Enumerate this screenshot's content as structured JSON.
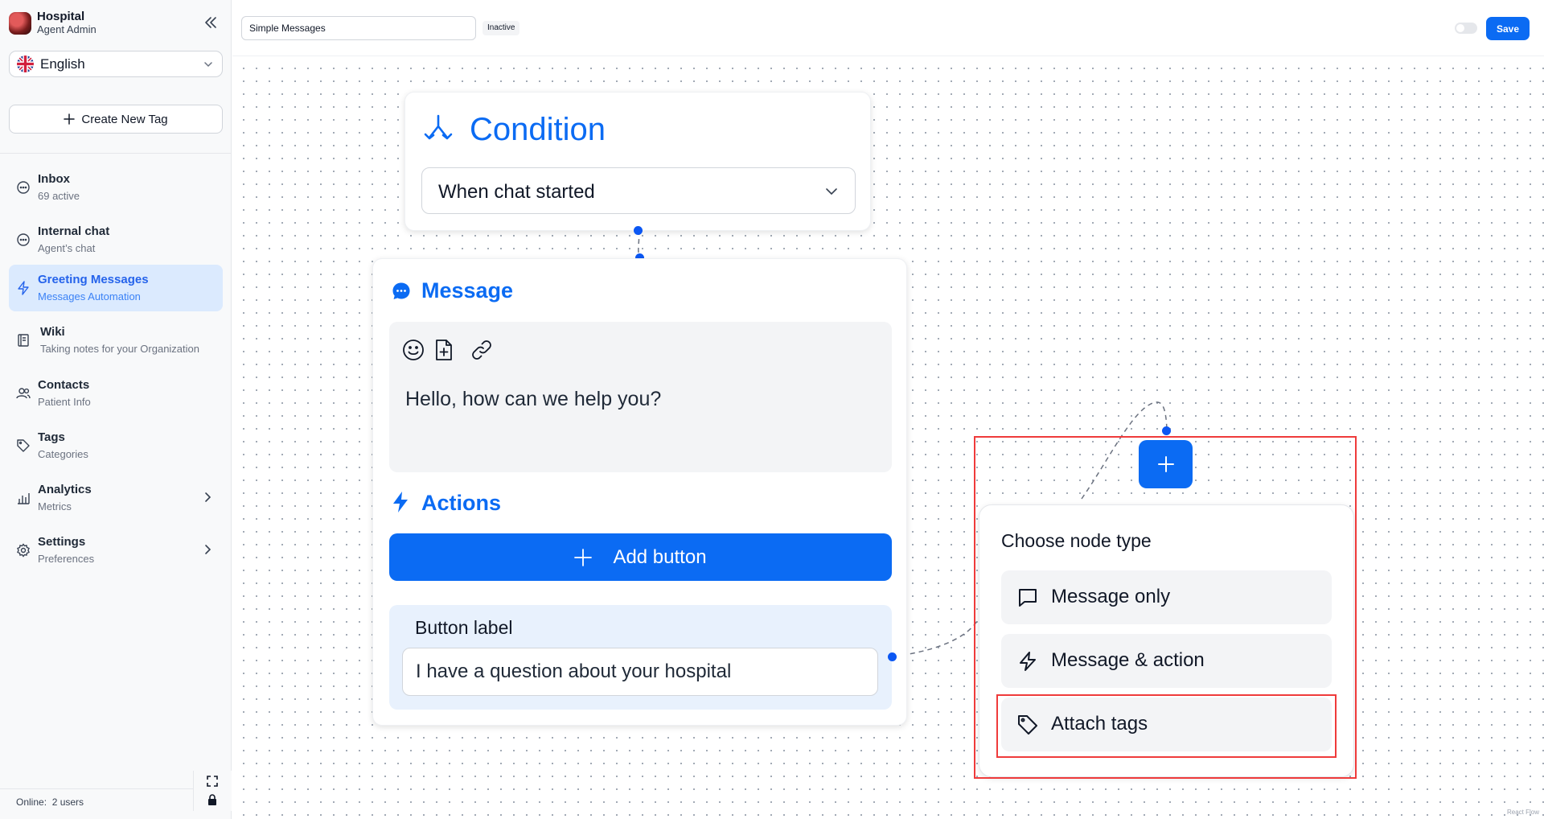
{
  "sidebar": {
    "brand_name": "Hospital",
    "brand_role": "Agent Admin",
    "language": "English",
    "create_tag_label": "Create New Tag",
    "items": [
      {
        "title": "Inbox",
        "sub": "69 active"
      },
      {
        "title": "Internal chat",
        "sub": "Agent’s chat"
      },
      {
        "title": "Greeting Messages",
        "sub": "Messages Automation"
      },
      {
        "title": "Wiki",
        "sub": "Taking notes for your Organization"
      },
      {
        "title": "Contacts",
        "sub": "Patient Info"
      },
      {
        "title": "Tags",
        "sub": "Categories"
      },
      {
        "title": "Analytics",
        "sub": "Metrics"
      },
      {
        "title": "Settings",
        "sub": "Preferences"
      }
    ],
    "online_label": "Online:",
    "online_value": "2 users"
  },
  "header": {
    "flow_name": "Simple Messages",
    "status": "Inactive",
    "save_label": "Save"
  },
  "condition_node": {
    "title": "Condition",
    "selected": "When chat started"
  },
  "message_node": {
    "title": "Message",
    "text": "Hello, how can we help you?",
    "actions_title": "Actions",
    "add_button_label": "Add button",
    "button_label_title": "Button label",
    "button_label_value": "I have a question about your hospital"
  },
  "node_chooser": {
    "title": "Choose node type",
    "options": [
      {
        "label": "Message only",
        "icon": "message-square-icon"
      },
      {
        "label": "Message & action",
        "icon": "lightning-icon"
      },
      {
        "label": "Attach tags",
        "icon": "tag-icon"
      }
    ]
  },
  "attribution": "React Flow",
  "colors": {
    "accent": "#0b6bf3",
    "highlight": "#ef3b3b",
    "active_nav_bg": "#dbeafe"
  }
}
